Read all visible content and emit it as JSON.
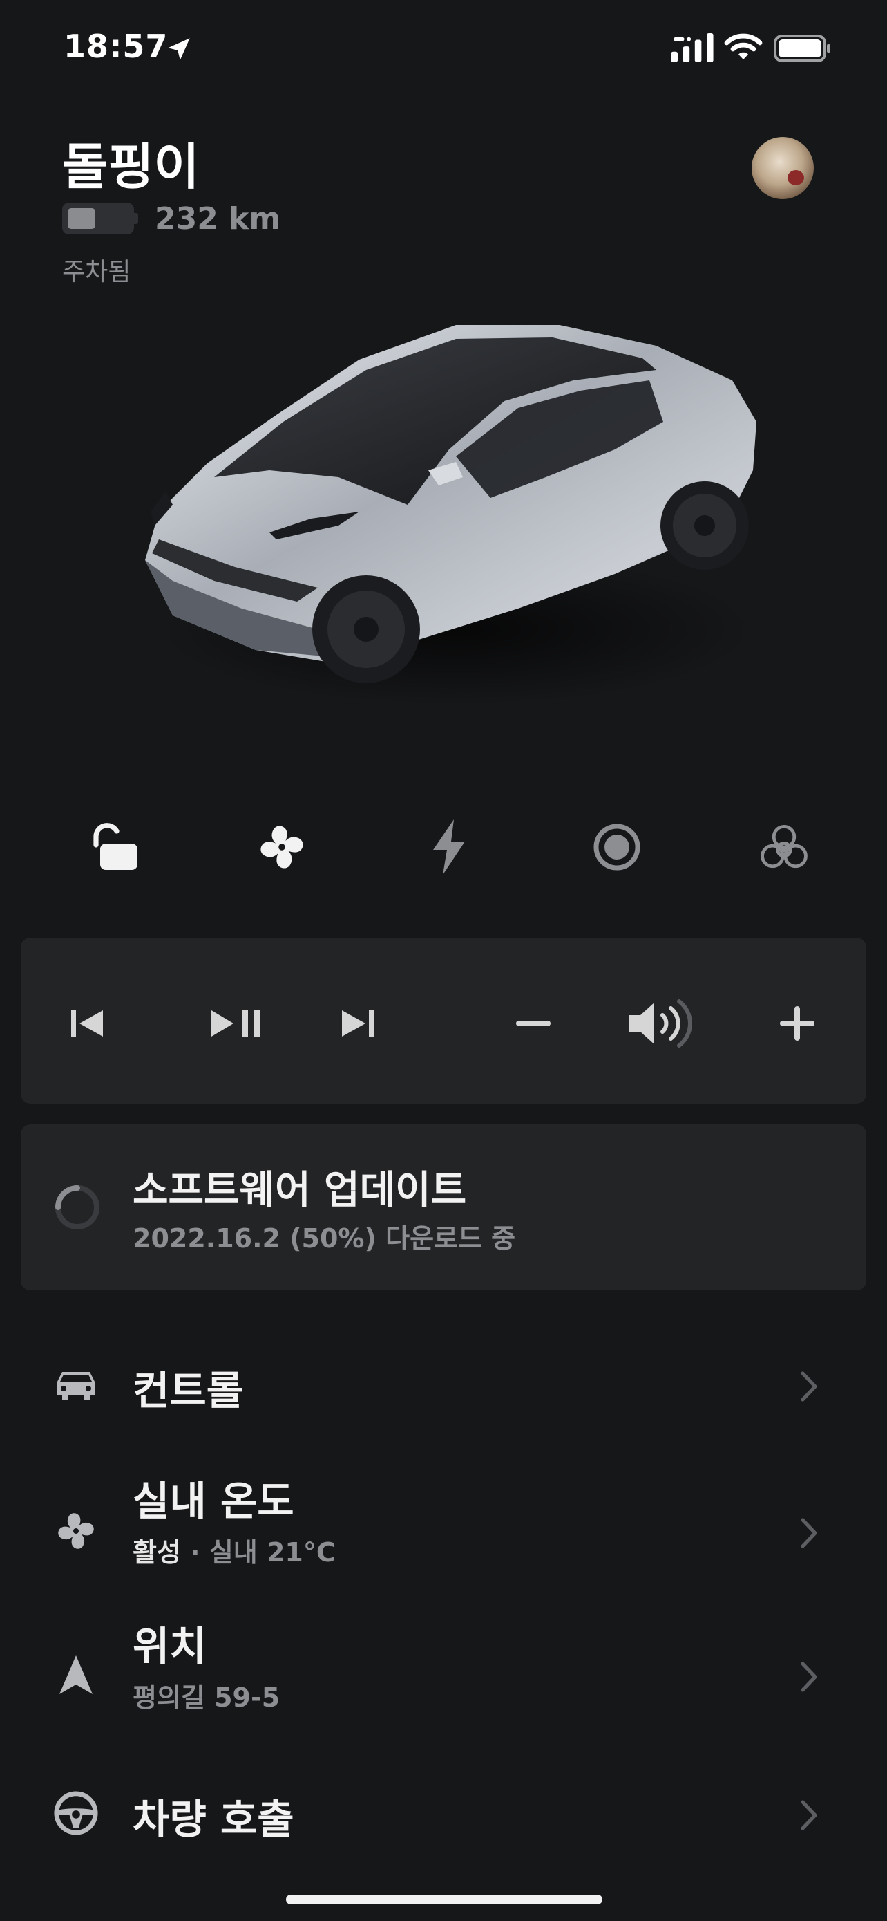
{
  "status_bar": {
    "time": "18:57"
  },
  "vehicle": {
    "name": "돌핑이",
    "range": "232 km",
    "battery_level": 0.45,
    "status": "주차됨"
  },
  "quick_actions": [
    {
      "name": "unlock-icon"
    },
    {
      "name": "fan-icon"
    },
    {
      "name": "charge-bolt-icon"
    },
    {
      "name": "record-icon"
    },
    {
      "name": "biohazard-icon"
    }
  ],
  "media_controls": [
    "previous-track-icon",
    "play-pause-icon",
    "next-track-icon",
    "volume-down-icon",
    "speaker-icon",
    "volume-up-icon"
  ],
  "software_update": {
    "title": "소프트웨어 업데이트",
    "subtitle": "2022.16.2 (50%) 다운로드 중",
    "progress": 0.5
  },
  "menu": {
    "controls": {
      "title": "컨트롤"
    },
    "climate": {
      "title": "실내 온도",
      "sub_status": "활성",
      "sub_separator": " · ",
      "sub_detail": "실내 21°C"
    },
    "location": {
      "title": "위치",
      "subtitle": "평의길 59-5"
    },
    "summon": {
      "title": "차량 호출"
    }
  },
  "colors": {
    "background": "#161719",
    "card": "#232426",
    "text_primary": "#f2f2f2",
    "text_secondary": "#8d8e92"
  }
}
